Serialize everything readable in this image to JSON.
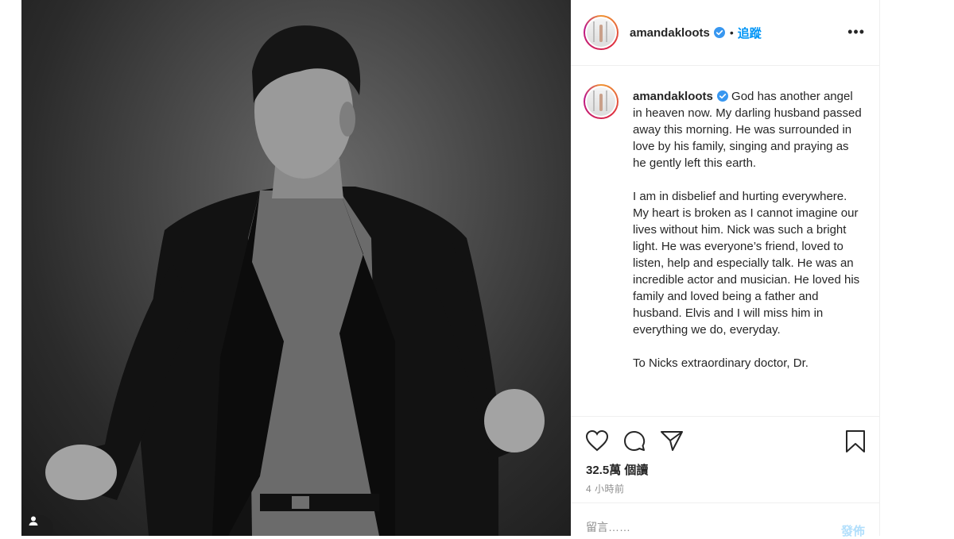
{
  "photo": {
    "alt_icon": "user-tag-icon"
  },
  "header": {
    "username": "amandakloots",
    "dot": "•",
    "follow_label": "追蹤",
    "more_label": "•••"
  },
  "caption": {
    "username": "amandakloots",
    "text": "God has another angel in heaven now. My darling husband passed away this morning. He was surrounded in love by his family, singing and praying as he gently left this earth.\n\nI am in disbelief and hurting everywhere. My heart is broken as I cannot imagine our lives without him. Nick was such a bright light. He was everyone’s friend, loved to listen, help and especially talk. He was an incredible actor and musician. He loved his family and loved being a father and husband. Elvis and I will miss him in everything we do, everyday.\n\nTo Nicks extraordinary doctor, Dr."
  },
  "actions": {
    "like_icon": "heart-icon",
    "comment_icon": "comment-icon",
    "share_icon": "share-icon",
    "save_icon": "bookmark-icon",
    "views": "32.5萬 個讀",
    "time_ago": "4 小時前"
  },
  "comment": {
    "placeholder": "留言……",
    "post_label": "發佈"
  },
  "colors": {
    "accent": "#0095f6",
    "verified": "#3897f0",
    "post_disabled": "#b2dffc",
    "muted": "#8e8e8e"
  }
}
